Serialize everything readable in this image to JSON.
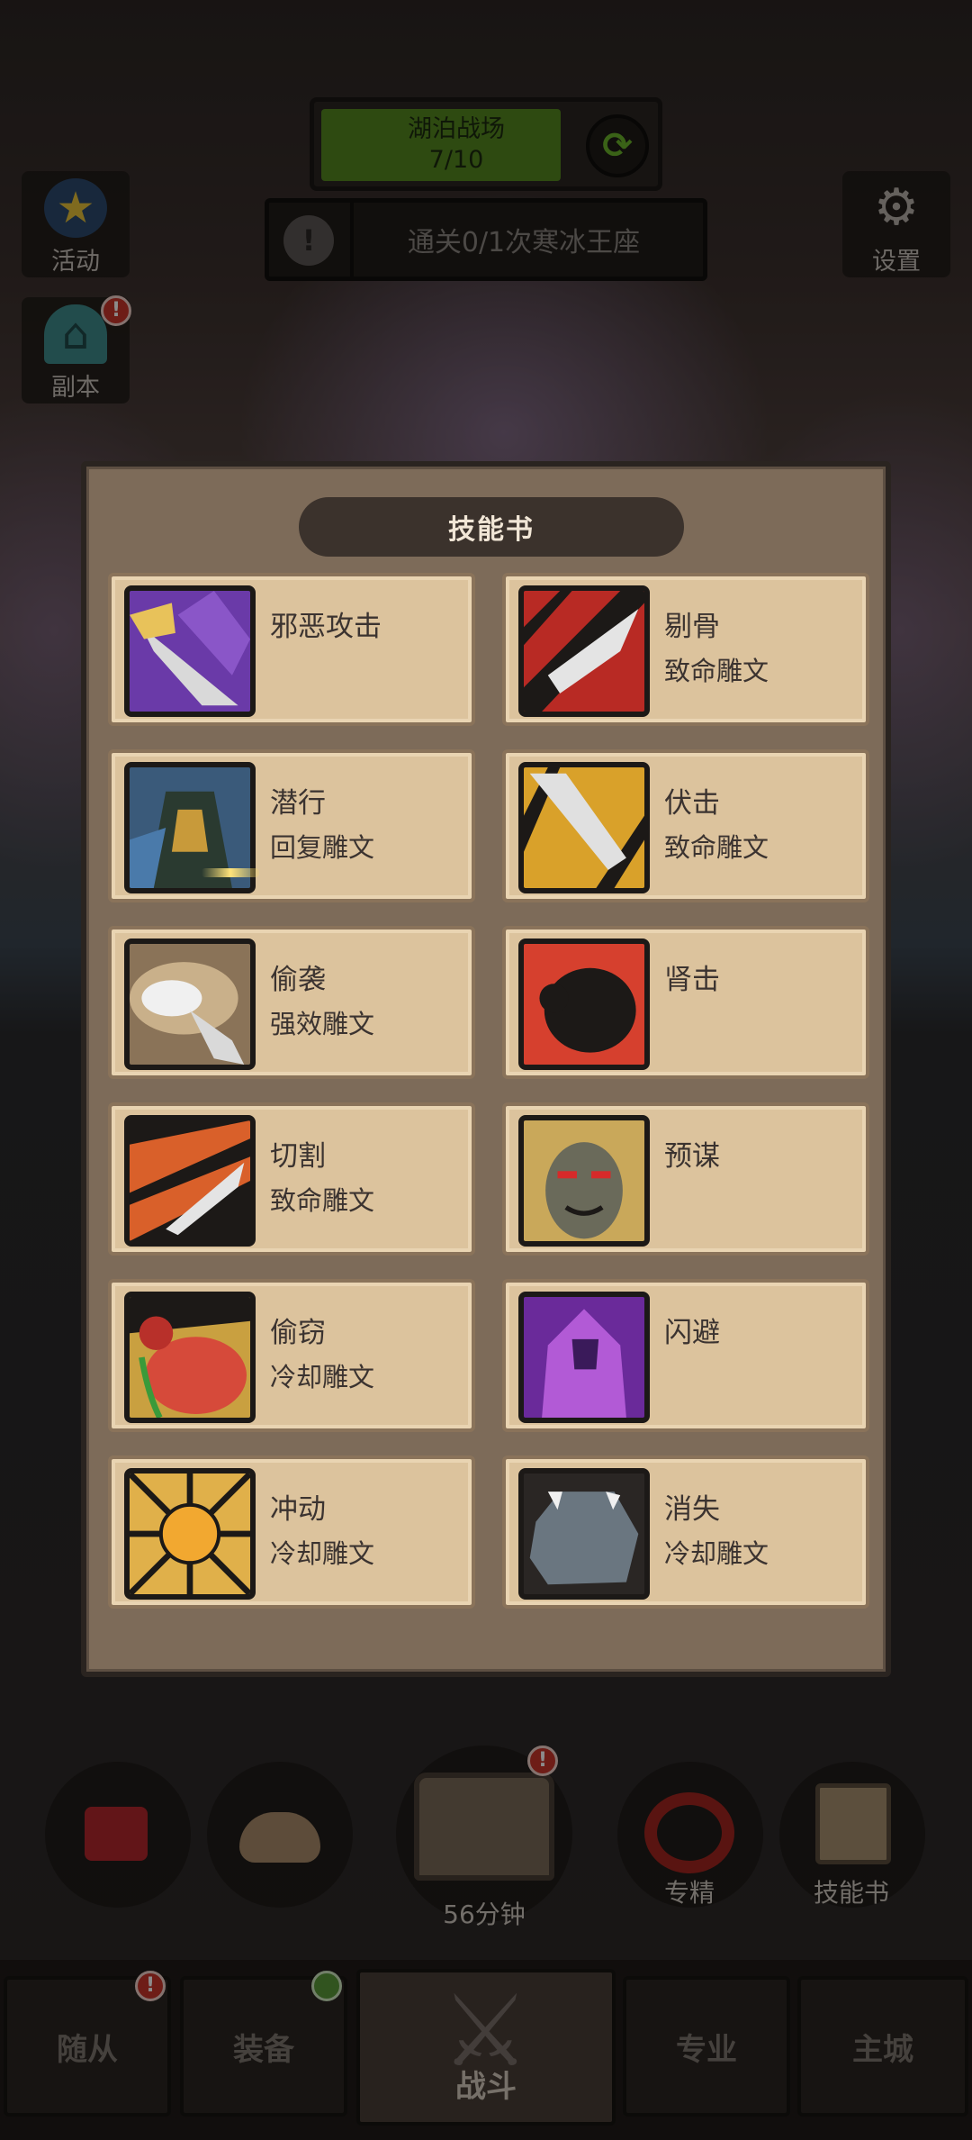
{
  "hud": {
    "stage_name": "湖泊战场",
    "stage_progress": "7/10",
    "stage_progress_fraction": 0.7,
    "quest_text": "通关0/1次寒冰王座",
    "activity_label": "活动",
    "dungeon_label": "副本",
    "settings_label": "设置",
    "badge_mark": "!"
  },
  "modal": {
    "title": "技能书",
    "skills": [
      {
        "name": "邪恶攻击",
        "rune": "",
        "icon": "purple-sword-icon"
      },
      {
        "name": "剔骨",
        "rune": "致命雕文",
        "icon": "red-blade-icon"
      },
      {
        "name": "潜行",
        "rune": "回复雕文",
        "icon": "hooded-rogue-icon"
      },
      {
        "name": "伏击",
        "rune": "致命雕文",
        "icon": "yellow-dagger-icon"
      },
      {
        "name": "偷袭",
        "rune": "强效雕文",
        "icon": "sneak-attack-icon"
      },
      {
        "name": "肾击",
        "rune": "",
        "icon": "kidney-shot-icon"
      },
      {
        "name": "切割",
        "rune": "致命雕文",
        "icon": "slice-icon"
      },
      {
        "name": "预谋",
        "rune": "",
        "icon": "premeditation-face-icon"
      },
      {
        "name": "偷窃",
        "rune": "冷却雕文",
        "icon": "loot-bag-icon"
      },
      {
        "name": "闪避",
        "rune": "",
        "icon": "evasion-hood-icon"
      },
      {
        "name": "冲动",
        "rune": "冷却雕文",
        "icon": "adrenaline-icon"
      },
      {
        "name": "消失",
        "rune": "冷却雕文",
        "icon": "vanish-rock-icon"
      }
    ]
  },
  "bottom": {
    "chest_timer": "56分钟",
    "specialize_label": "专精",
    "skillbook_label": "技能书"
  },
  "nav": {
    "followers": "随从",
    "equipment": "装备",
    "battle": "战斗",
    "profession": "专业",
    "city": "主城"
  },
  "colors": {
    "card_bg": "#dcc39d",
    "modal_bg": "#7d6b59",
    "progress_green": "#55871f",
    "badge_red": "#c8352b"
  }
}
